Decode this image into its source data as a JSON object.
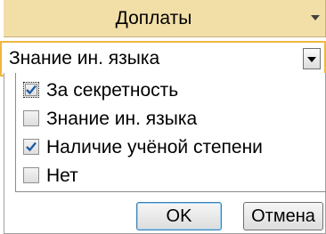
{
  "column_header": {
    "title": "Доплаты",
    "dropdown_icon": "chevron-down-icon"
  },
  "combo": {
    "value": "Знание ин. языка",
    "dropdown_icon": "chevron-down-icon",
    "accent_color": "#f0b642"
  },
  "filter_list": {
    "items": [
      {
        "label": "За секретность",
        "checked": true,
        "focused": true
      },
      {
        "label": "Знание ин. языка",
        "checked": false,
        "focused": false
      },
      {
        "label": "Наличие учёной степени",
        "checked": true,
        "focused": false
      },
      {
        "label": "Нет",
        "checked": false,
        "focused": false
      }
    ],
    "check_icon": "checkmark-icon",
    "check_color": "#1f5fa8"
  },
  "buttons": {
    "ok_label": "OK",
    "cancel_label": "Отмена"
  },
  "colors": {
    "header_bg": "#f2dfa8"
  }
}
